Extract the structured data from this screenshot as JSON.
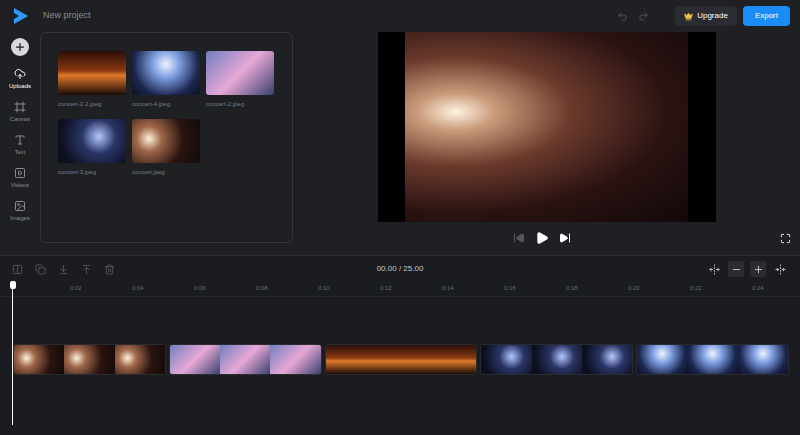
{
  "header": {
    "project_title": "New project",
    "undo_disabled": true,
    "redo_disabled": true,
    "buttons": [
      {
        "kind": "upgrade",
        "label": "Upgrade"
      },
      {
        "kind": "export",
        "label": "Export"
      }
    ]
  },
  "sidebar": {
    "items": [
      {
        "kind": "uploads",
        "label": "Uploads",
        "selected": true
      },
      {
        "kind": "canvas",
        "label": "Canvas",
        "selected": false
      },
      {
        "kind": "text",
        "label": "Text",
        "selected": false
      },
      {
        "kind": "videos",
        "label": "Videos",
        "selected": false
      },
      {
        "kind": "images",
        "label": "Images",
        "selected": false
      }
    ]
  },
  "media": {
    "files": [
      {
        "name": "concert-2-2.jpeg"
      },
      {
        "name": "concert-4.jpeg"
      },
      {
        "name": "concert-2.jpeg"
      },
      {
        "name": "concert-3.jpeg"
      },
      {
        "name": "concert.jpeg"
      }
    ]
  },
  "player": {
    "controls": [
      {
        "kind": "previous",
        "disabled": true
      },
      {
        "kind": "play",
        "disabled": false
      },
      {
        "kind": "next",
        "disabled": false
      }
    ]
  },
  "timeline": {
    "time": "00.00 / 25.00",
    "tools": [
      {
        "kind": "split",
        "disabled": true
      },
      {
        "kind": "duplicate",
        "disabled": true
      },
      {
        "kind": "move-down",
        "disabled": true
      },
      {
        "kind": "move-up",
        "disabled": true
      },
      {
        "kind": "delete",
        "disabled": true
      }
    ],
    "zoom": [
      {
        "kind": "fit"
      },
      {
        "kind": "zoom-out"
      },
      {
        "kind": "zoom-in"
      },
      {
        "kind": "collapse"
      }
    ],
    "ruler": [
      "0:02",
      "0:04",
      "0:06",
      "0:08",
      "0:10",
      "0:12",
      "0:14",
      "0:16",
      "0:18",
      "0:20",
      "0:22",
      "0:24"
    ],
    "playhead": {
      "level": 0
    },
    "clips": [
      {
        "selected": false
      },
      {
        "selected": false
      },
      {
        "selected": false
      },
      {
        "selected": false
      },
      {
        "selected": false
      }
    ]
  }
}
